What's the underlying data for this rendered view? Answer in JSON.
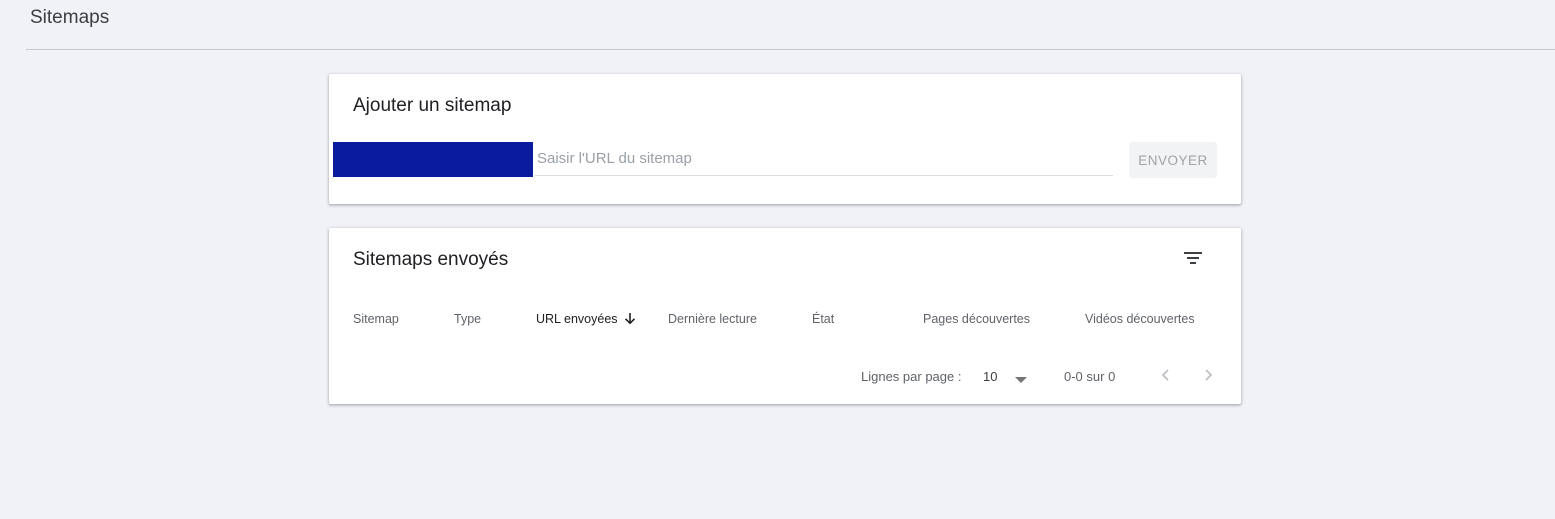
{
  "header": {
    "title": "Sitemaps"
  },
  "add_sitemap": {
    "title": "Ajouter un sitemap",
    "url_placeholder": "Saisir l'URL du sitemap",
    "url_value": "",
    "redacted_prefix_color": "#0a1ba0",
    "submit_label": "ENVOYER"
  },
  "sent_sitemaps": {
    "title": "Sitemaps envoyés",
    "filter_icon": "filter-list-icon",
    "columns": [
      {
        "label": "Sitemap"
      },
      {
        "label": "Type"
      },
      {
        "label": "URL envoyées",
        "sorted": "descending"
      },
      {
        "label": "Dernière lecture"
      },
      {
        "label": "État"
      },
      {
        "label": "Pages découvertes"
      },
      {
        "label": "Vidéos découvertes"
      }
    ],
    "rows": [],
    "pagination": {
      "rows_per_page_label": "Lignes par page :",
      "rows_per_page_value": "10",
      "range_label": "0-0 sur 0"
    }
  },
  "colors": {
    "background": "#f0f2f7",
    "card": "#ffffff",
    "text_primary": "#202124",
    "text_secondary": "#5f6368"
  }
}
